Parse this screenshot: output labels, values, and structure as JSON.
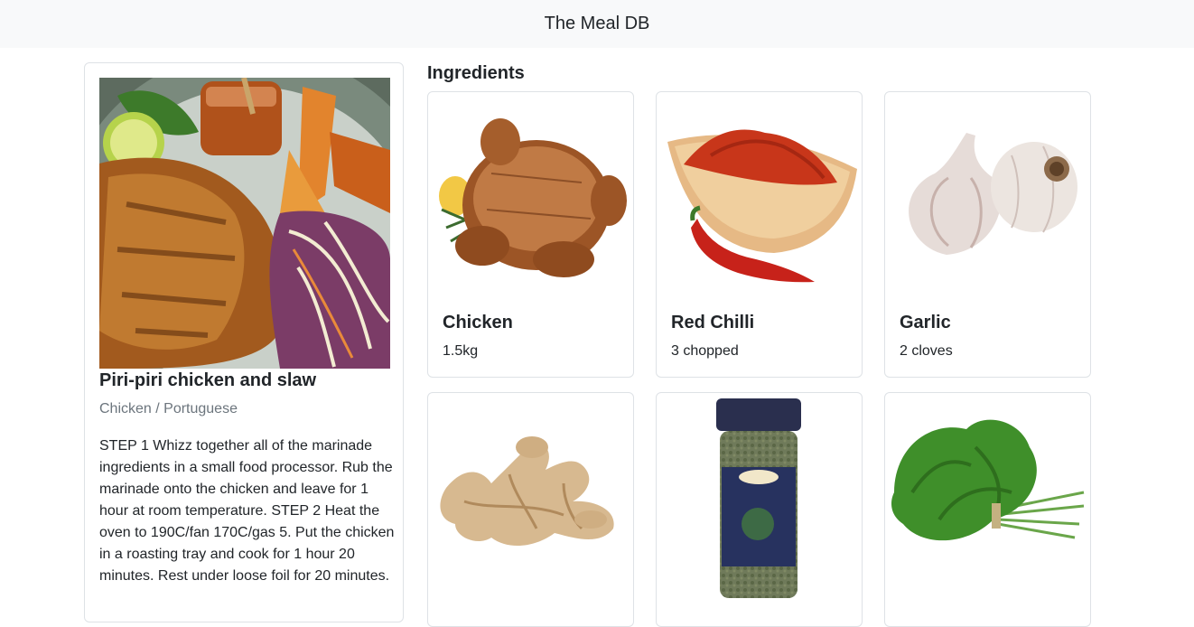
{
  "nav": {
    "brand": "The Meal DB"
  },
  "recipe": {
    "title": "Piri-piri chicken and slaw",
    "subtitle": "Chicken / Portuguese",
    "instructions": "STEP 1 Whizz together all of the marinade ingredients in a small food processor. Rub the marinade onto the chicken and leave for 1 hour at room temperature. STEP 2 Heat the oven to 190C/fan 170C/gas 5. Put the chicken in a roasting tray and cook for 1 hour 20 minutes. Rest under loose foil for 20 minutes."
  },
  "ingredients": {
    "heading": "Ingredients",
    "items": [
      {
        "name": "Chicken",
        "measure": "1.5kg",
        "icon": "roast-chicken"
      },
      {
        "name": "Red Chilli",
        "measure": "3 chopped",
        "icon": "chilli-powder-bowl"
      },
      {
        "name": "Garlic",
        "measure": "2 cloves",
        "icon": "garlic-bulbs"
      },
      {
        "name": "",
        "measure": "",
        "icon": "ginger-root"
      },
      {
        "name": "",
        "measure": "",
        "icon": "oregano-jar"
      },
      {
        "name": "",
        "measure": "",
        "icon": "parsley-bunch"
      }
    ]
  }
}
